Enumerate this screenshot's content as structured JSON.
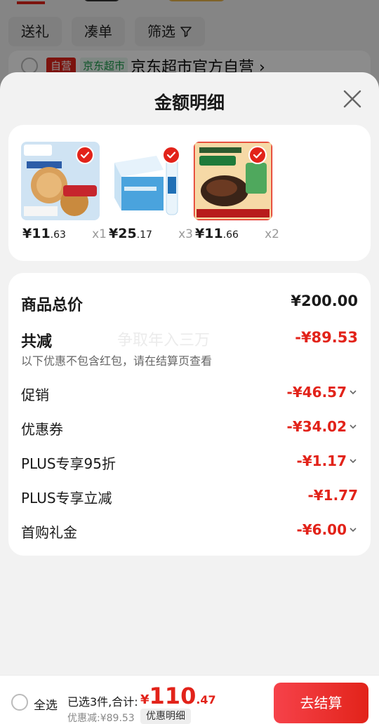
{
  "background": {
    "chips": [
      "送礼",
      "凑单",
      "筛选"
    ],
    "shop_tag_self": "自营",
    "shop_tag_market": "京东超市",
    "shop_name": "京东超市官方自营"
  },
  "sheet": {
    "title": "金额明细"
  },
  "products": [
    {
      "price_int": "¥11",
      "price_dec": ".63",
      "qty": "x1"
    },
    {
      "price_int": "¥25",
      "price_dec": ".17",
      "qty": "x3"
    },
    {
      "price_int": "¥11",
      "price_dec": ".66",
      "qty": "x2"
    }
  ],
  "summary": {
    "total_label": "商品总价",
    "total_value": "¥200.00",
    "reduce_label": "共减",
    "reduce_value": "-¥89.53",
    "note": "以下优惠不包含红包，请在结算页查看",
    "watermark": "争取年入三万",
    "items": [
      {
        "label": "促销",
        "value": "-¥46.57"
      },
      {
        "label": "优惠券",
        "value": "-¥34.02"
      },
      {
        "label": "PLUS专享95折",
        "value": "-¥1.17"
      },
      {
        "label": "PLUS专享立减",
        "value": "-¥1.77"
      },
      {
        "label": "首购礼金",
        "value": "-¥6.00"
      }
    ]
  },
  "bottom": {
    "select_all": "全选",
    "selected_info": "已选3件,合计:",
    "total_currency": "¥",
    "total_int": "110",
    "total_dec": ".47",
    "discount_line": "优惠减:¥89.53",
    "detail_button": "优惠明细",
    "checkout_button": "去结算"
  },
  "colors": {
    "accent": "#e2231a",
    "sheet_bg": "#f2f2f2",
    "card_bg": "#ffffff"
  }
}
